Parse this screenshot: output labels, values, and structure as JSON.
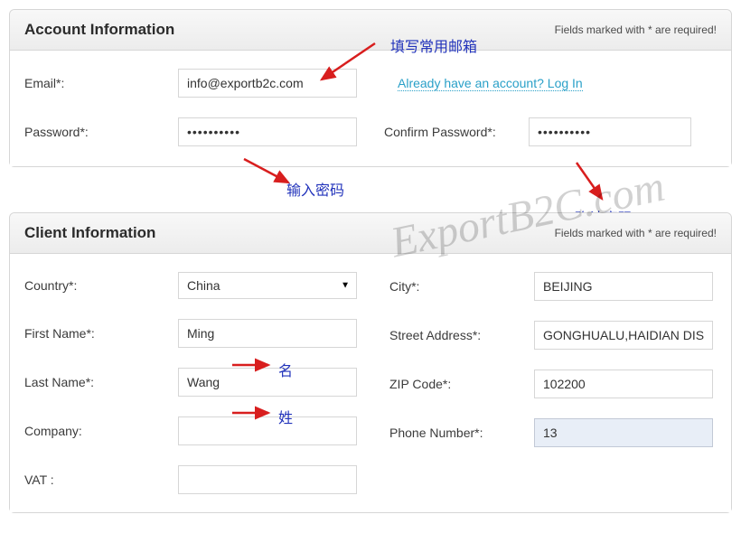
{
  "account": {
    "title": "Account Information",
    "required_note": "Fields marked with * are required!",
    "email_label": "Email*:",
    "email_value": "info@exportb2c.com",
    "login_link": "Already have an account? Log In",
    "password_label": "Password*:",
    "password_value": "••••••••••",
    "confirm_password_label": "Confirm Password*:",
    "confirm_password_value": "••••••••••"
  },
  "client": {
    "title": "Client Information",
    "required_note": "Fields marked with * are required!",
    "country_label": "Country*:",
    "country_value": "China",
    "firstname_label": "First Name*:",
    "firstname_value": "Ming",
    "lastname_label": "Last Name*:",
    "lastname_value": "Wang",
    "company_label": "Company:",
    "company_value": "",
    "vat_label": "VAT :",
    "vat_value": "",
    "city_label": "City*:",
    "city_value": "BEIJING",
    "street_label": "Street Address*:",
    "street_value": "GONGHUALU,HAIDIAN DISTRICT",
    "zip_label": "ZIP Code*:",
    "zip_value": "102200",
    "phone_label": "Phone Number*:",
    "phone_value": "13"
  },
  "annotations": {
    "fill_email": "填写常用邮箱",
    "enter_password": "输入密码",
    "confirm_password": "确认密码",
    "given_name": "名",
    "surname": "姓"
  },
  "watermark": "ExportB2C.com"
}
